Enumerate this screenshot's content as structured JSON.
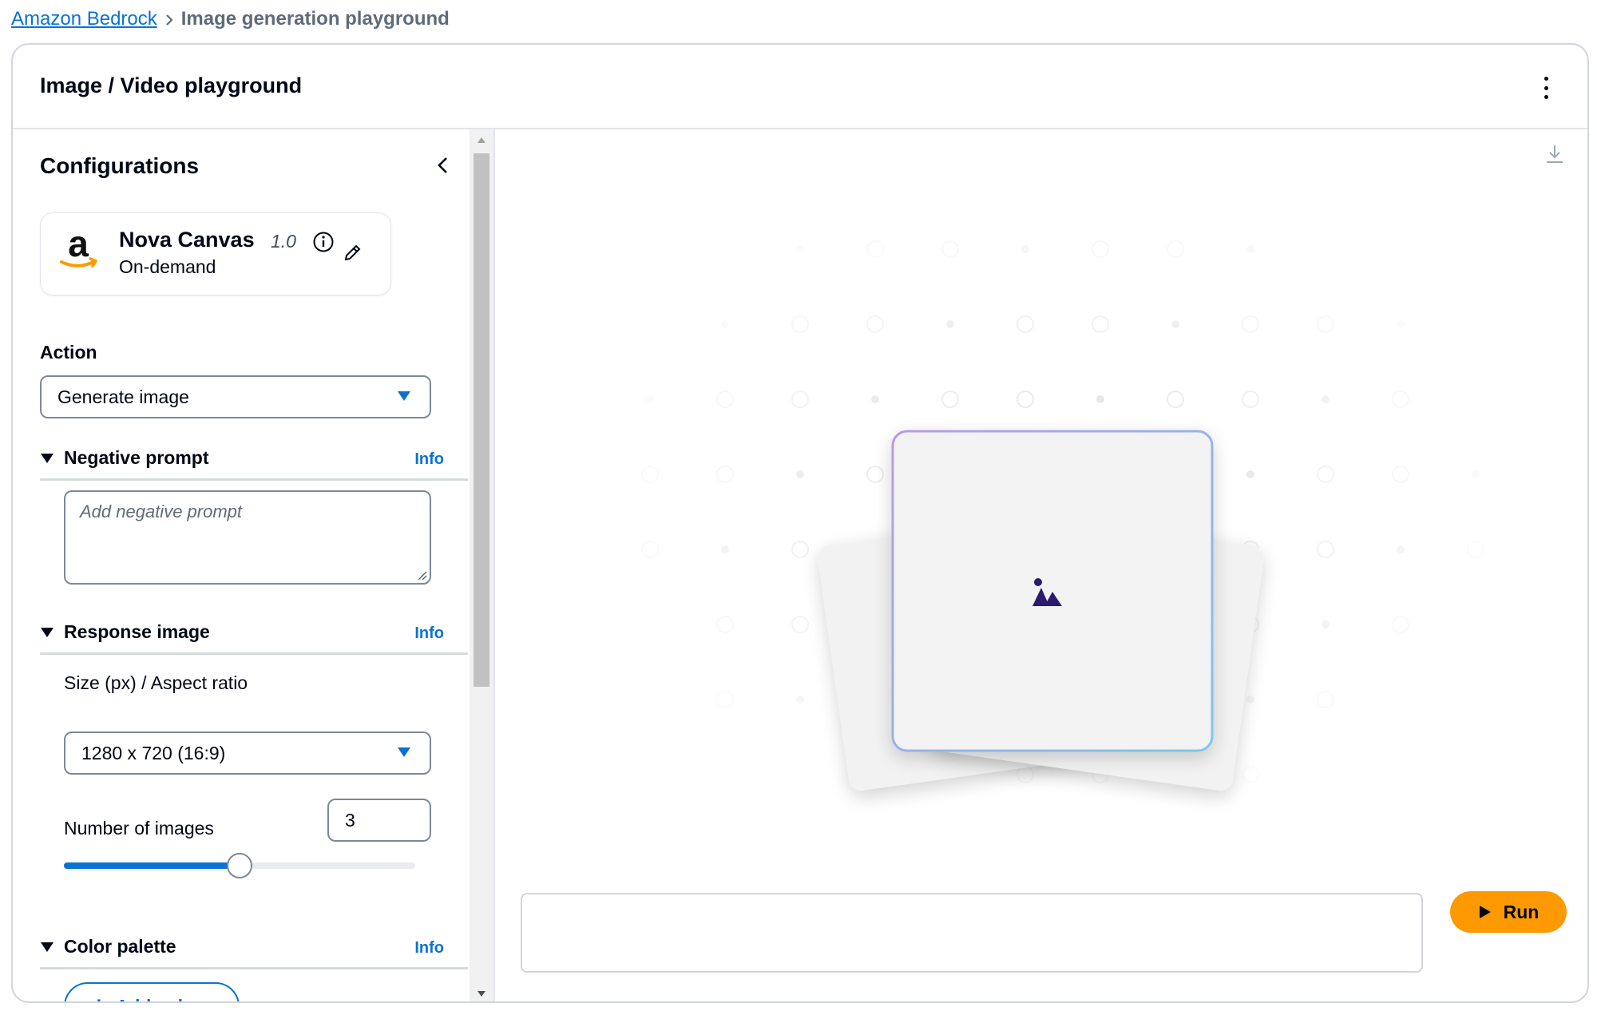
{
  "breadcrumb": {
    "root": "Amazon Bedrock",
    "current": "Image generation playground"
  },
  "header": {
    "title": "Image / Video playground",
    "menu_icon": "kebab-menu-icon"
  },
  "configurations": {
    "title": "Configurations",
    "collapse_icon": "chevron-left-icon",
    "model": {
      "name": "Nova Canvas",
      "version": "1.0",
      "mode": "On-demand",
      "logo": "amazon-logo"
    },
    "action": {
      "label": "Action",
      "value": "Generate image"
    },
    "negative_prompt": {
      "label": "Negative prompt",
      "info": "Info",
      "placeholder": "Add negative prompt",
      "expanded": true
    },
    "response_image": {
      "label": "Response image",
      "info": "Info",
      "expanded": true,
      "size_label": "Size (px) / Aspect ratio",
      "size_value": "1280 x 720 (16:9)",
      "num_images_label": "Number of images",
      "num_images_value": "3",
      "slider_fraction": 0.5
    },
    "color_palette": {
      "label": "Color palette",
      "info": "Info",
      "expanded": true,
      "add_button": "Add colors"
    }
  },
  "canvas": {
    "download_icon": "download-icon",
    "placeholder_icon": "image-placeholder-icon",
    "prompt_value": "",
    "run_label": "Run"
  },
  "colors": {
    "accent": "#0972d3",
    "run": "#ff9900",
    "placeholder_icon": "#2b1a6e"
  }
}
